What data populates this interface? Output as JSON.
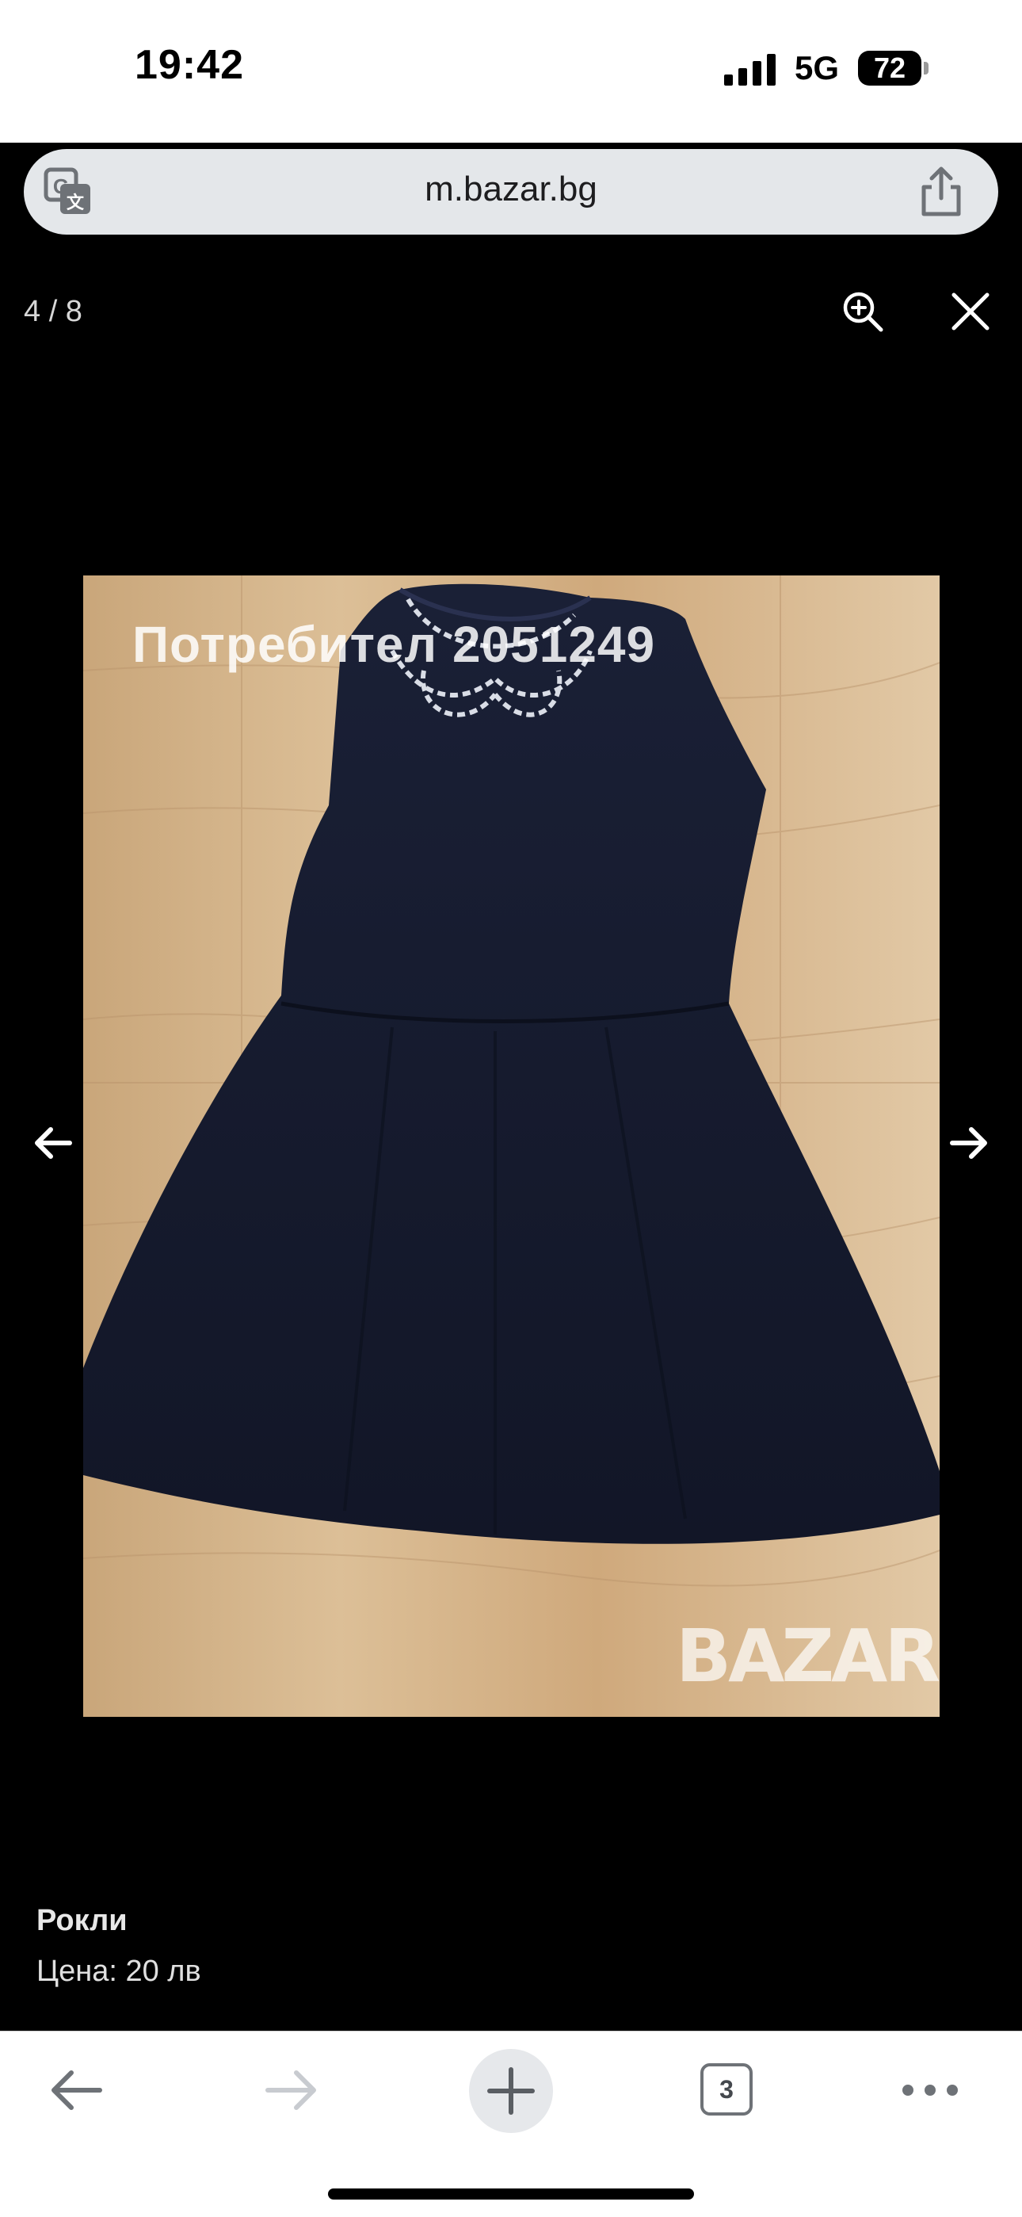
{
  "status_bar": {
    "time": "19:42",
    "network": "5G",
    "battery": "72"
  },
  "browser": {
    "url": "m.bazar.bg",
    "tab_count": "3"
  },
  "viewer": {
    "counter": "4 / 8",
    "watermark_user": "Потребител 2051249",
    "watermark_logo": "BAZAR",
    "category": "Рокли",
    "price": "Цена: 20 лв"
  },
  "colors": {
    "viewer_bg": "#000000",
    "dress": "#14192b",
    "floor": "#d2b48c"
  },
  "icons": [
    "signal-icon",
    "translate-icon",
    "share-icon",
    "zoom-in-icon",
    "close-icon",
    "arrow-left-icon",
    "arrow-right-icon",
    "back-icon",
    "forward-icon",
    "plus-icon",
    "more-icon"
  ]
}
